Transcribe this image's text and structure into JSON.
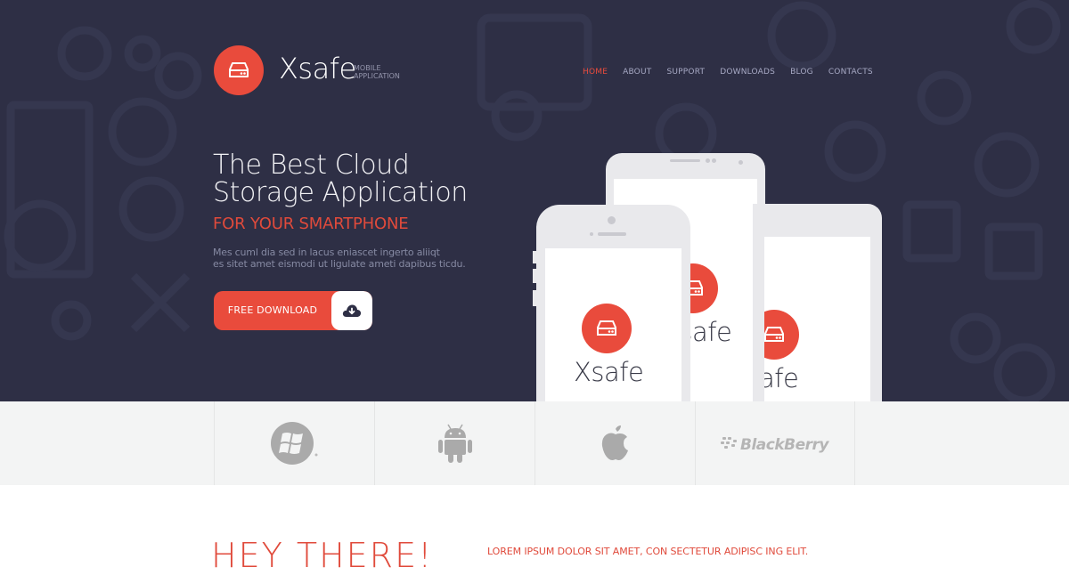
{
  "brand": {
    "name": "Xsafe",
    "tagline_line1": "MOBILE",
    "tagline_line2": "APPLICATION",
    "logo_icon": "hard-drive-icon",
    "accent_color": "#e94b3c"
  },
  "nav": {
    "items": [
      {
        "label": "HOME",
        "active": true
      },
      {
        "label": "ABOUT",
        "active": false
      },
      {
        "label": "SUPPORT",
        "active": false
      },
      {
        "label": "DOWNLOADS",
        "active": false
      },
      {
        "label": "BLOG",
        "active": false
      },
      {
        "label": "CONTACTS",
        "active": false
      }
    ]
  },
  "hero": {
    "title_line1": "The Best Cloud",
    "title_line2": "Storage Application",
    "subtitle": "FOR YOUR SMARTPHONE",
    "description_line1": "Mes cuml dia sed in lacus eniascet ingerto aliiqt",
    "description_line2": "es sitet amet eismodi ut ligulate ameti dapibus ticdu.",
    "download_button": {
      "label": "FREE DOWNLOAD",
      "icon": "cloud-download-icon"
    }
  },
  "phones": {
    "app_name": "Xsafe",
    "app_name_partial": "afe"
  },
  "platforms": [
    {
      "name": "Windows Phone",
      "icon": "windows-icon"
    },
    {
      "name": "Android",
      "icon": "android-icon"
    },
    {
      "name": "Apple",
      "icon": "apple-icon"
    },
    {
      "name": "BlackBerry",
      "icon": "blackberry-icon",
      "wordmark": "BlackBerry"
    }
  ],
  "intro": {
    "heading": "HEY THERE!",
    "lead": "LOREM IPSUM DOLOR SIT AMET, CON SECTETUR ADIPISC ING ELIT."
  }
}
